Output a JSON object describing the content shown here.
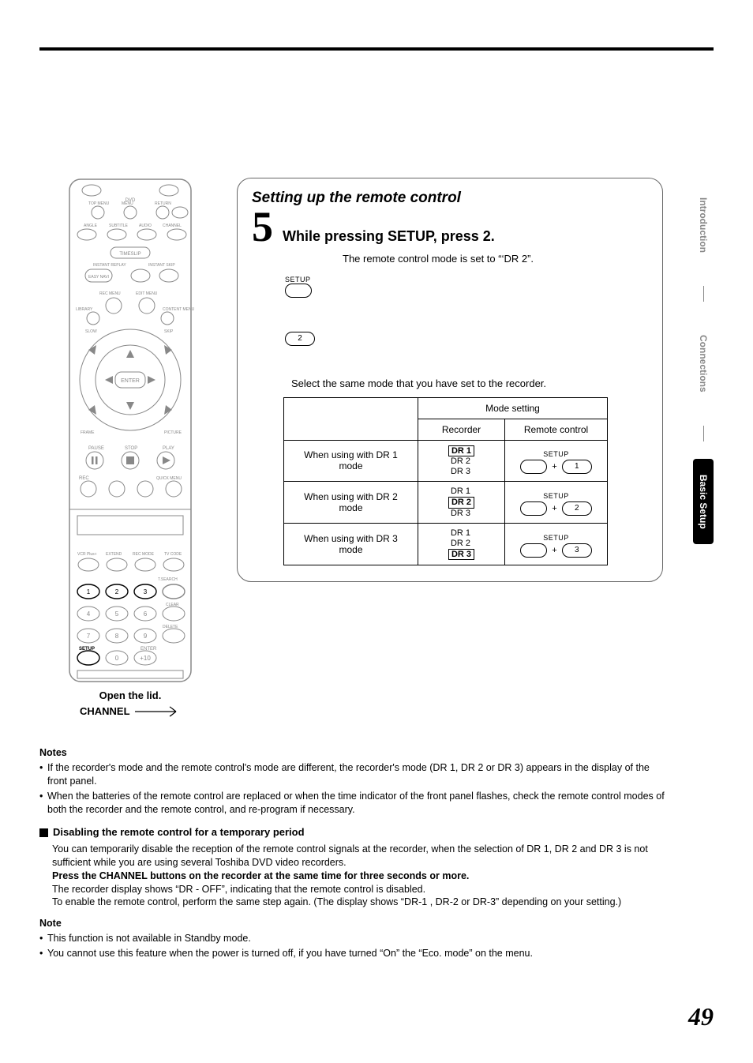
{
  "sidebar": {
    "tabs": [
      "Introduction",
      "Connections",
      "Basic Setup"
    ]
  },
  "remote": {
    "open_lid": "Open the lid.",
    "channel": "CHANNEL"
  },
  "content": {
    "title": "Setting up the remote control",
    "step_num": "5",
    "step_text": "While pressing SETUP, press 2.",
    "mode_note": "The remote control mode is set to “‘DR 2”.",
    "setup_label": "SETUP",
    "btn2": "2",
    "select_note": "Select the same mode that you have set to the recorder.",
    "table": {
      "col_recorder": "Recorder",
      "col_remote": "Remote control",
      "mode_setting": "Mode setting",
      "rows": [
        {
          "label": "When using with DR 1 mode",
          "sel": 0,
          "num": "1"
        },
        {
          "label": "When using with DR 2 mode",
          "sel": 1,
          "num": "2"
        },
        {
          "label": "When using with DR 3 mode",
          "sel": 2,
          "num": "3"
        }
      ],
      "dr_items": [
        "DR  1",
        "DR  2",
        "DR  3"
      ],
      "plus": "+"
    }
  },
  "notes1": {
    "heading": "Notes",
    "items": [
      "If the recorder's mode and the remote control's mode are different, the recorder's mode (DR 1, DR 2 or DR 3) appears in the display of the front panel.",
      "When the batteries of the remote control are replaced or when the time indicator of the front panel flashes, check the remote control modes of both the recorder and the remote control, and re-program if necessary."
    ]
  },
  "disable": {
    "heading": "Disabling the remote control for a temporary period",
    "lines": [
      "You can temporarily disable the reception of the remote control signals at the recorder, when the selection of DR 1, DR 2 and DR 3 is not sufficient while you are using several Toshiba DVD video recorders.",
      "Press the CHANNEL buttons on the recorder at the same time for three seconds or more.",
      "The recorder display shows “DR - OFF”, indicating that the remote control is disabled.",
      "To enable the remote control, perform the same step again. (The display shows “DR-1 , DR-2 or DR-3” depending on your setting.)"
    ]
  },
  "notes2": {
    "heading": "Note",
    "items": [
      "This function is not available in Standby mode.",
      "You cannot use this feature when the power is turned off, if you have turned “On” the “Eco. mode” on the menu."
    ]
  },
  "page_number": "49"
}
